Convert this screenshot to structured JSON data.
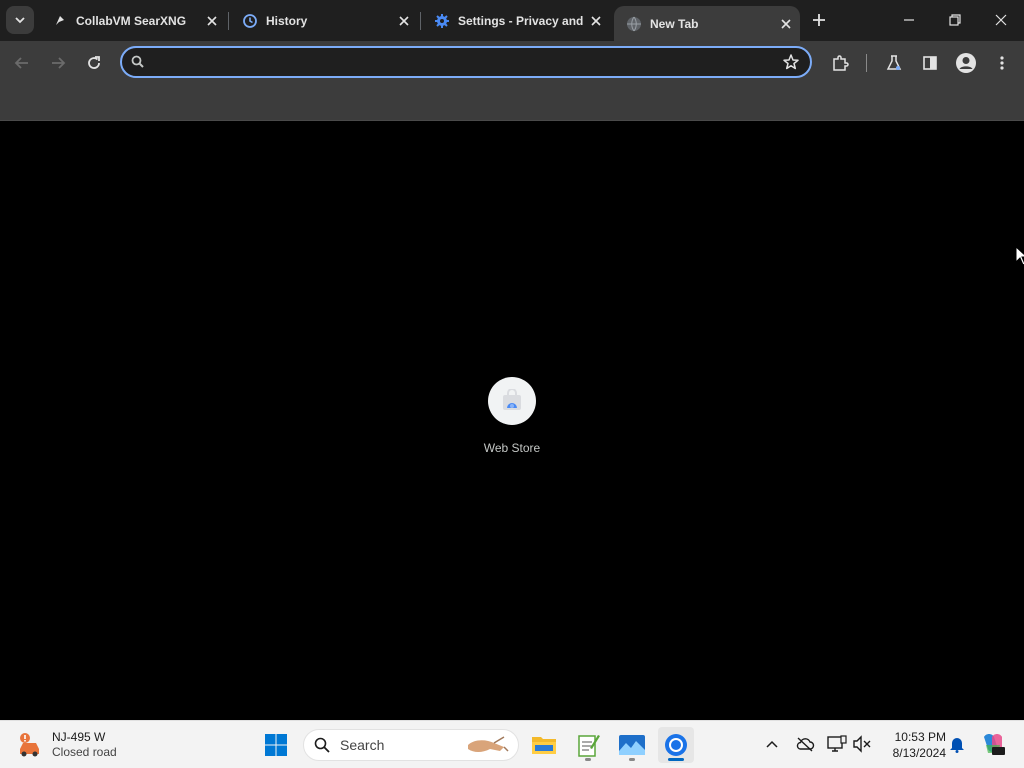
{
  "browser": {
    "tabs": [
      {
        "title": "CollabVM SearXNG",
        "favicon": "searxng-icon",
        "active": false
      },
      {
        "title": "History",
        "favicon": "history-icon",
        "active": false
      },
      {
        "title": "Settings - Privacy and",
        "favicon": "settings-gear-icon",
        "active": false
      },
      {
        "title": "New Tab",
        "favicon": "globe-icon",
        "active": true
      }
    ],
    "omnibox": {
      "value": "",
      "placeholder": ""
    },
    "accent_color": "#7cacf8"
  },
  "new_tab": {
    "shortcuts": [
      {
        "label": "Web Store",
        "icon": "web-store-icon"
      }
    ]
  },
  "taskbar": {
    "weather": {
      "line1": "NJ-495 W",
      "line2": "Closed road",
      "icon": "traffic-alert-icon"
    },
    "search_label": "Search",
    "apps": [
      "start-icon",
      "file-explorer-icon",
      "notepad-icon",
      "photos-icon",
      "chrome-icon"
    ],
    "clock": {
      "time": "10:53 PM",
      "date": "8/13/2024"
    }
  }
}
